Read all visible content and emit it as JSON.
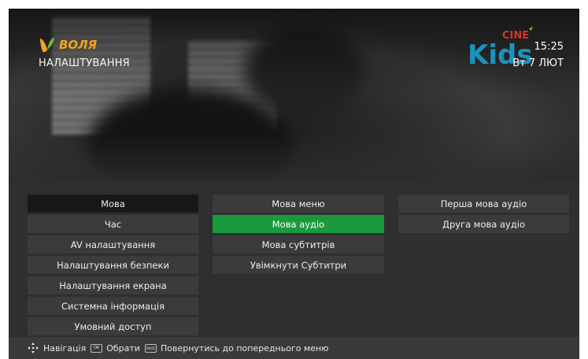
{
  "header": {
    "brand_name": "ВОЛЯ",
    "page_title": "НАЛАШТУВАННЯ",
    "channel_logo": {
      "text_main": "Kids",
      "text_small": "CINE"
    },
    "time": "15:25",
    "date": "Вт 7 ЛЮТ"
  },
  "menu": {
    "main_items": [
      {
        "label": "Мова"
      },
      {
        "label": "Час"
      },
      {
        "label": "AV налаштування"
      },
      {
        "label": "Налаштування безпеки"
      },
      {
        "label": "Налаштування екрана"
      },
      {
        "label": "Системна інформація"
      },
      {
        "label": "Умовний доступ"
      }
    ],
    "sub_items": [
      {
        "label": "Мова меню"
      },
      {
        "label": "Мова аудіо"
      },
      {
        "label": "Мова субтитрів"
      },
      {
        "label": "Увімкнути Субтитри"
      }
    ],
    "audio_items": [
      {
        "label": "Перша мова аудіо"
      },
      {
        "label": "Друга мова аудіо"
      }
    ]
  },
  "footer": {
    "nav_label": "Навігація",
    "ok_key": "OK",
    "select_label": "Обрати",
    "back_key": "BACK",
    "back_label": "Повернутись до попереднього меню"
  },
  "colors": {
    "selected": "#1a9a3c",
    "brand_orange": "#f2a41b",
    "channel_blue": "#1aa6d9",
    "channel_red": "#e33a2c"
  },
  "icons": [
    "logo-mark",
    "nav-arrows-icon",
    "ok-key-icon",
    "back-key-icon"
  ]
}
